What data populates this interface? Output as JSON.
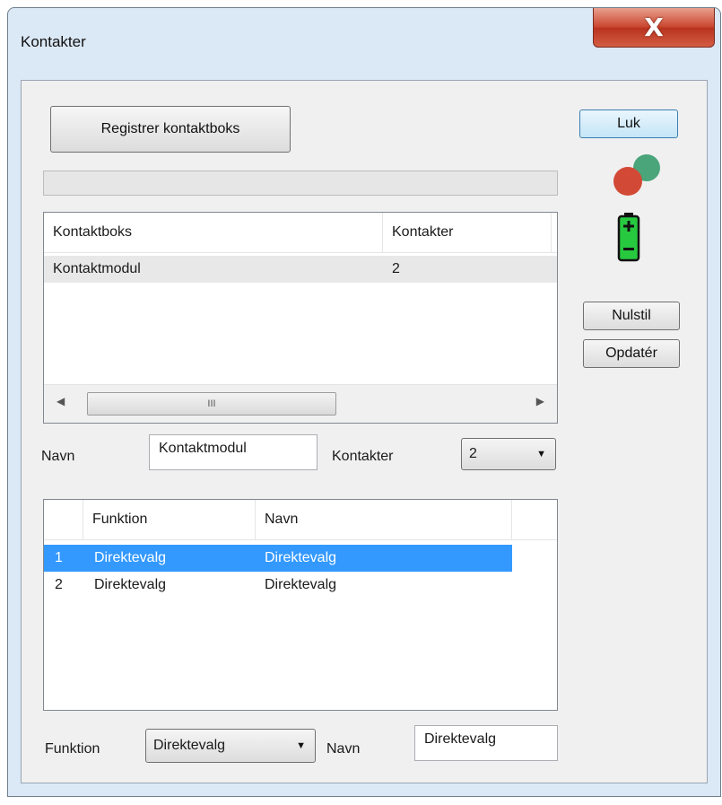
{
  "window": {
    "title": "Kontakter",
    "close_glyph": "X"
  },
  "buttons": {
    "register": "Registrer kontaktboks",
    "close": "Luk",
    "reset": "Nulstil",
    "update": "Opdatér"
  },
  "boxes_table": {
    "headers": [
      "Kontaktboks",
      "Kontakter"
    ],
    "rows": [
      [
        "Kontaktmodul",
        "2"
      ]
    ],
    "scroll_thumb_glyph": "III"
  },
  "box_form": {
    "name_label": "Navn",
    "name_value": "Kontaktmodul",
    "count_label": "Kontakter",
    "count_value": "2"
  },
  "functions_table": {
    "headers": [
      "",
      "Funktion",
      "Navn"
    ],
    "rows": [
      [
        "1",
        "Direktevalg",
        "Direktevalg"
      ],
      [
        "2",
        "Direktevalg",
        "Direktevalg"
      ]
    ],
    "selected_row": 0
  },
  "function_form": {
    "function_label": "Funktion",
    "function_value": "Direktevalg",
    "name_label": "Navn",
    "name_value": "Direktevalg"
  },
  "icons": {
    "status": "connection-status-icon",
    "battery": "battery-icon"
  },
  "colors": {
    "selection": "#3399ff",
    "status_red": "#d24a36",
    "status_green": "#4aa57a",
    "battery_green": "#27c93f"
  }
}
